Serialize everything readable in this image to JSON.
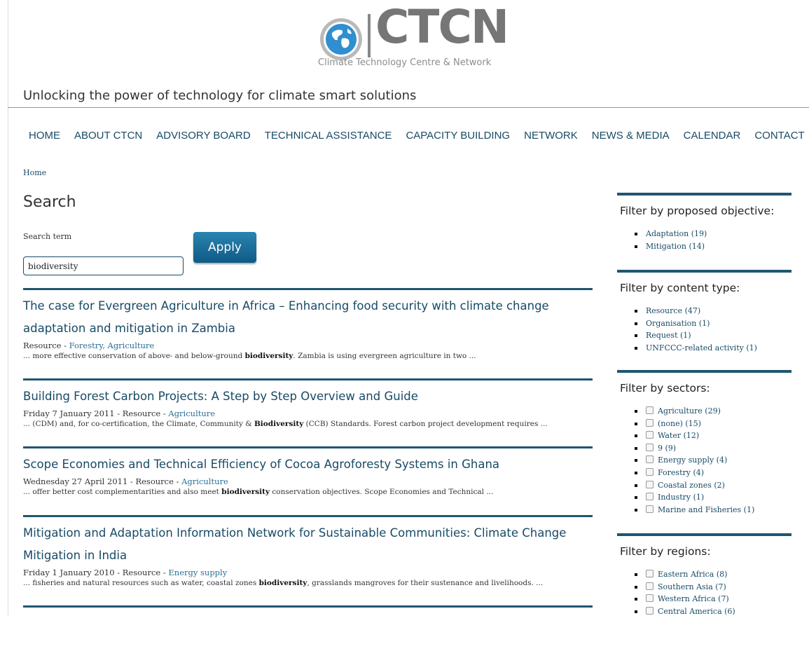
{
  "header": {
    "logo_word": "CTCN",
    "logo_sub": "Climate Technology Centre & Network",
    "tagline": "Unlocking the power of technology for climate smart solutions"
  },
  "nav": [
    "HOME",
    "ABOUT CTCN",
    "ADVISORY BOARD",
    "TECHNICAL ASSISTANCE",
    "CAPACITY BUILDING",
    "NETWORK",
    "NEWS & MEDIA",
    "CALENDAR",
    "CONTACT"
  ],
  "breadcrumb": "Home",
  "page_title": "Search",
  "search": {
    "label": "Search term",
    "value": "biodiversity",
    "apply_label": "Apply"
  },
  "results": [
    {
      "title": "The case for Evergreen Agriculture in Africa – Enhancing food security with climate change adaptation and mitigation in Zambia",
      "meta_prefix": "Resource - ",
      "tags": "Forestry, Agriculture",
      "snippet_pre": "... more effective conservation of above- and below-ground ",
      "highlight": "biodiversity",
      "snippet_post": ". Zambia is using evergreen agriculture in two ..."
    },
    {
      "title": "Building Forest Carbon Projects: A Step by Step Overview and Guide",
      "meta_prefix": "Friday 7 January 2011 - Resource - ",
      "tags": "Agriculture",
      "snippet_pre": "... (CDM) and, for co-certification, the Climate, Community & ",
      "highlight": "Biodiversity",
      "snippet_post": " (CCB) Standards. Forest carbon project development requires ..."
    },
    {
      "title": "Scope Economies and Technical Efficiency of Cocoa Agroforesty Systems in Ghana",
      "meta_prefix": "Wednesday 27 April 2011 - Resource - ",
      "tags": "Agriculture",
      "snippet_pre": "... offer better cost complementarities and also meet ",
      "highlight": "biodiversity",
      "snippet_post": " conservation objectives. Scope Economies and Technical ..."
    },
    {
      "title": "Mitigation and Adaptation Information Network for Sustainable Communities: Climate Change Mitigation in India",
      "meta_prefix": "Friday 1 January 2010 - Resource - ",
      "tags": "Energy supply",
      "snippet_pre": "... fisheries and natural resources such as water, coastal zones ",
      "highlight": "biodiversity",
      "snippet_post": ", grasslands mangroves for their sustenance and livelihoods. ..."
    }
  ],
  "sidebar": {
    "objective": {
      "title": "Filter by proposed objective:",
      "items": [
        "Adaptation (19)",
        "Mitigation (14)"
      ]
    },
    "content_type": {
      "title": "Filter by content type:",
      "items": [
        "Resource (47)",
        "Organisation (1)",
        "Request (1)",
        "UNFCCC-related activity (1)"
      ]
    },
    "sectors": {
      "title": "Filter by sectors:",
      "items": [
        "Agriculture (29)",
        "(none) (15)",
        "Water (12)",
        "9 (9)",
        "Energy supply (4)",
        "Forestry (4)",
        "Coastal zones (2)",
        "Industry (1)",
        "Marine and Fisheries (1)"
      ]
    },
    "regions": {
      "title": "Filter by regions:",
      "items": [
        "Eastern Africa (8)",
        "Southern Asia (7)",
        "Western Africa (7)",
        "Central America (6)"
      ]
    }
  },
  "colors": {
    "brand_dark": "#184a66",
    "rule": "#1f5670",
    "button_top": "#2a84b0",
    "button_bottom": "#0f5a86"
  }
}
